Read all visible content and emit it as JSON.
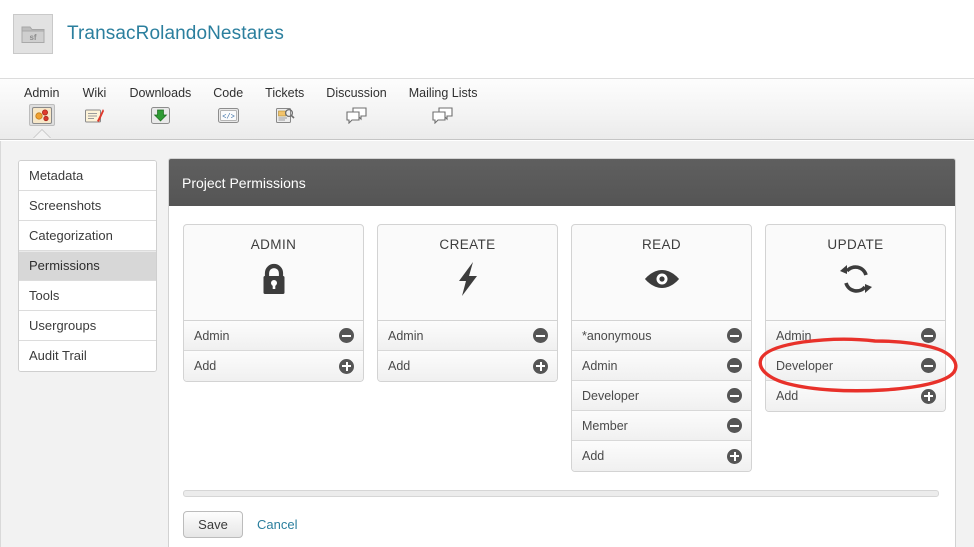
{
  "project": {
    "title": "TransacRolandoNestares",
    "icon": "folder-sf-icon",
    "title_color": "#2b7f9e"
  },
  "topnav": {
    "tabs": [
      {
        "label": "Admin",
        "icon": "admin-gear-photo-icon",
        "active": true
      },
      {
        "label": "Wiki",
        "icon": "wiki-pencil-page-icon",
        "active": false
      },
      {
        "label": "Downloads",
        "icon": "download-arrow-icon",
        "active": false
      },
      {
        "label": "Code",
        "icon": "code-brackets-icon",
        "active": false
      },
      {
        "label": "Tickets",
        "icon": "tickets-page-icon",
        "active": false
      },
      {
        "label": "Discussion",
        "icon": "speech-bubbles-icon",
        "active": false
      },
      {
        "label": "Mailing Lists",
        "icon": "speech-bubbles-icon",
        "active": false
      }
    ]
  },
  "sidebar": {
    "items": [
      {
        "label": "Metadata",
        "active": false
      },
      {
        "label": "Screenshots",
        "active": false
      },
      {
        "label": "Categorization",
        "active": false
      },
      {
        "label": "Permissions",
        "active": true
      },
      {
        "label": "Tools",
        "active": false
      },
      {
        "label": "Usergroups",
        "active": false
      },
      {
        "label": "Audit Trail",
        "active": false
      }
    ]
  },
  "panel": {
    "heading": "Project Permissions",
    "cards": [
      {
        "title": "ADMIN",
        "icon": "lock-icon",
        "rows": [
          {
            "label": "Admin",
            "action": "remove"
          },
          {
            "label": "Add",
            "action": "add"
          }
        ]
      },
      {
        "title": "CREATE",
        "icon": "lightning-bolt-icon",
        "rows": [
          {
            "label": "Admin",
            "action": "remove"
          },
          {
            "label": "Add",
            "action": "add"
          }
        ]
      },
      {
        "title": "READ",
        "icon": "eye-icon",
        "rows": [
          {
            "label": "*anonymous",
            "action": "remove"
          },
          {
            "label": "Admin",
            "action": "remove"
          },
          {
            "label": "Developer",
            "action": "remove"
          },
          {
            "label": "Member",
            "action": "remove"
          },
          {
            "label": "Add",
            "action": "add"
          }
        ]
      },
      {
        "title": "UPDATE",
        "icon": "refresh-cycle-icon",
        "rows": [
          {
            "label": "Admin",
            "action": "remove"
          },
          {
            "label": "Developer",
            "action": "remove"
          },
          {
            "label": "Add",
            "action": "add"
          }
        ]
      }
    ]
  },
  "footer": {
    "save_label": "Save",
    "cancel_label": "Cancel"
  },
  "annotation": {
    "shape": "hand-drawn-ellipse",
    "color": "#e8312a",
    "targets": "UPDATE card Developer row"
  }
}
